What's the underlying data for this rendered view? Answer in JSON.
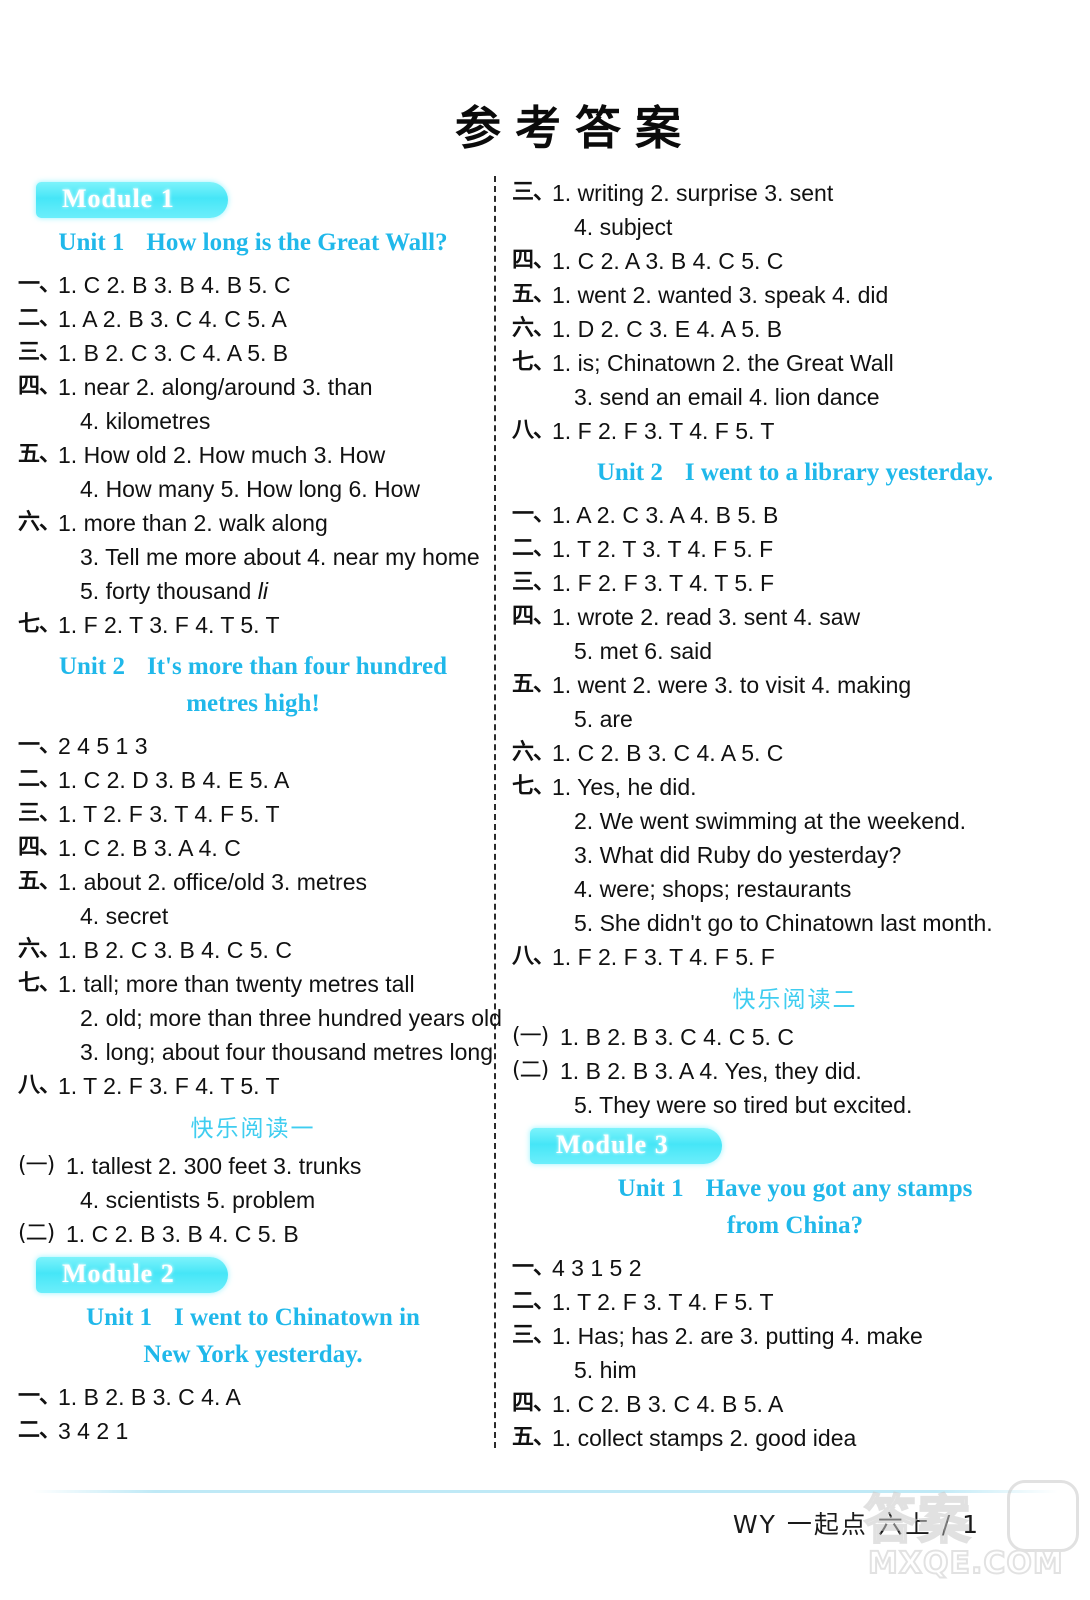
{
  "title": "参考答案",
  "footer": {
    "text": "WY 一起点 六上 / 1"
  },
  "watermark": {
    "cn": "答案",
    "en": "MXQE.COM"
  },
  "colors": {
    "accent_cyan": "#20b8ea",
    "badge_cyan": "#46e6f7",
    "reading_cyan": "#3fcdf0"
  },
  "left_column": [
    {
      "type": "module",
      "label": "Module 1"
    },
    {
      "type": "unit",
      "unit": "Unit 1",
      "name": "How long is the Great Wall?"
    },
    {
      "type": "answer",
      "num": "一、",
      "body": "1. C   2. B   3. B   4. B   5. C"
    },
    {
      "type": "answer",
      "num": "二、",
      "body": "1. A   2. B   3. C   4. C   5. A"
    },
    {
      "type": "answer",
      "num": "三、",
      "body": "1. B   2. C   3. C   4. A   5. B"
    },
    {
      "type": "answer",
      "num": "四、",
      "body": "1. near   2. along/around   3. than"
    },
    {
      "type": "answer-cont",
      "num": "",
      "body": "4. kilometres"
    },
    {
      "type": "answer",
      "num": "五、",
      "body": "1. How old   2. How much   3. How"
    },
    {
      "type": "answer-cont",
      "num": "",
      "body": "4. How many   5. How long   6. How"
    },
    {
      "type": "answer",
      "num": "六、",
      "body": "1. more than   2. walk along"
    },
    {
      "type": "answer-cont",
      "num": "",
      "body": "3. Tell me more about   4. near my home"
    },
    {
      "type": "answer-cont",
      "num": "",
      "body": "5. forty thousand li",
      "italic_tail": "li"
    },
    {
      "type": "answer",
      "num": "七、",
      "body": "1. F   2. T   3. F   4. T   5. T"
    },
    {
      "type": "unit",
      "unit": "Unit 2",
      "name": "It's more than four hundred",
      "name2": "metres high!"
    },
    {
      "type": "answer",
      "num": "一、",
      "body": "2   4   5   1   3"
    },
    {
      "type": "answer",
      "num": "二、",
      "body": "1. C   2. D   3. B   4. E   5. A"
    },
    {
      "type": "answer",
      "num": "三、",
      "body": "1. T   2. F   3. T   4. F   5. T"
    },
    {
      "type": "answer",
      "num": "四、",
      "body": "1. C   2. B   3. A   4. C"
    },
    {
      "type": "answer",
      "num": "五、",
      "body": "1. about   2. office/old   3. metres"
    },
    {
      "type": "answer-cont",
      "num": "",
      "body": "4. secret"
    },
    {
      "type": "answer",
      "num": "六、",
      "body": "1. B   2. C   3. B   4. C   5. C"
    },
    {
      "type": "answer",
      "num": "七、",
      "body": "1. tall; more than twenty metres tall"
    },
    {
      "type": "answer-cont",
      "num": "",
      "body": "2. old; more than three hundred years old"
    },
    {
      "type": "answer-cont",
      "num": "",
      "body": "3. long; about four thousand metres long"
    },
    {
      "type": "answer",
      "num": "八、",
      "body": "1. T   2. F   3. F   4. T   5. T"
    },
    {
      "type": "reading",
      "label": "快乐阅读一"
    },
    {
      "type": "answer-paren",
      "num": "(一)",
      "body": "1. tallest   2. 300 feet   3. trunks"
    },
    {
      "type": "answer-cont",
      "num": "",
      "body": "4. scientists   5. problem"
    },
    {
      "type": "answer-paren",
      "num": "(二)",
      "body": "1. C   2. B   3. B   4. C   5. B"
    },
    {
      "type": "module",
      "label": "Module 2"
    },
    {
      "type": "unit",
      "unit": "Unit 1",
      "name": "I went to Chinatown in",
      "name2": "New York yesterday."
    },
    {
      "type": "answer",
      "num": "一、",
      "body": "1. B   2. B   3. C   4. A"
    },
    {
      "type": "answer",
      "num": "二、",
      "body": "3   4   2   1"
    }
  ],
  "right_column": [
    {
      "type": "answer",
      "num": "三、",
      "body": "1. writing   2. surprise   3. sent"
    },
    {
      "type": "answer-cont",
      "num": "",
      "body": "4. subject"
    },
    {
      "type": "answer",
      "num": "四、",
      "body": "1. C   2. A   3. B   4. C   5. C"
    },
    {
      "type": "answer",
      "num": "五、",
      "body": "1. went   2. wanted   3. speak   4. did"
    },
    {
      "type": "answer",
      "num": "六、",
      "body": "1. D   2. C   3. E   4. A   5. B"
    },
    {
      "type": "answer",
      "num": "七、",
      "body": "1. is; Chinatown   2. the Great Wall"
    },
    {
      "type": "answer-cont",
      "num": "",
      "body": "3. send an email   4. lion dance"
    },
    {
      "type": "answer",
      "num": "八、",
      "body": "1. F   2. F   3. T   4. F   5. T"
    },
    {
      "type": "unit",
      "unit": "Unit 2",
      "name": "I went to a library yesterday."
    },
    {
      "type": "answer",
      "num": "一、",
      "body": "1. A   2. C   3. A   4. B   5. B"
    },
    {
      "type": "answer",
      "num": "二、",
      "body": "1. T   2. T   3. T   4. F   5. F"
    },
    {
      "type": "answer",
      "num": "三、",
      "body": "1. F   2. F   3. T   4. T   5. F"
    },
    {
      "type": "answer",
      "num": "四、",
      "body": "1. wrote   2. read   3. sent   4. saw"
    },
    {
      "type": "answer-cont",
      "num": "",
      "body": "5. met   6. said"
    },
    {
      "type": "answer",
      "num": "五、",
      "body": "1. went   2. were   3. to visit   4. making"
    },
    {
      "type": "answer-cont",
      "num": "",
      "body": "5. are"
    },
    {
      "type": "answer",
      "num": "六、",
      "body": "1. C   2. B   3. C   4. A   5. C"
    },
    {
      "type": "answer",
      "num": "七、",
      "body": "1. Yes, he did."
    },
    {
      "type": "answer-cont",
      "num": "",
      "body": "2. We went swimming at the weekend."
    },
    {
      "type": "answer-cont",
      "num": "",
      "body": "3. What did Ruby do yesterday?"
    },
    {
      "type": "answer-cont",
      "num": "",
      "body": "4. were; shops; restaurants"
    },
    {
      "type": "answer-cont",
      "num": "",
      "body": "5. She didn't go to Chinatown last month."
    },
    {
      "type": "answer",
      "num": "八、",
      "body": "1. F   2. F   3. T   4. F   5. F"
    },
    {
      "type": "reading",
      "label": "快乐阅读二"
    },
    {
      "type": "answer-paren",
      "num": "(一)",
      "body": "1. B   2. B   3. C   4. C   5. C"
    },
    {
      "type": "answer-paren",
      "num": "(二)",
      "body": "1. B   2. B   3. A   4. Yes, they did."
    },
    {
      "type": "answer-cont",
      "num": "",
      "body": "5. They were so tired but excited."
    },
    {
      "type": "module",
      "label": "Module 3"
    },
    {
      "type": "unit",
      "unit": "Unit 1",
      "name": "Have you got any stamps",
      "name2": "from China?"
    },
    {
      "type": "answer",
      "num": "一、",
      "body": "4   3   1   5   2"
    },
    {
      "type": "answer",
      "num": "二、",
      "body": "1. T   2. F   3. T   4. F   5. T"
    },
    {
      "type": "answer",
      "num": "三、",
      "body": "1. Has; has   2. are   3. putting   4. make"
    },
    {
      "type": "answer-cont",
      "num": "",
      "body": "5. him"
    },
    {
      "type": "answer",
      "num": "四、",
      "body": "1. C   2. B   3. C   4. B   5. A"
    },
    {
      "type": "answer",
      "num": "五、",
      "body": "1. collect stamps   2. good idea"
    }
  ]
}
